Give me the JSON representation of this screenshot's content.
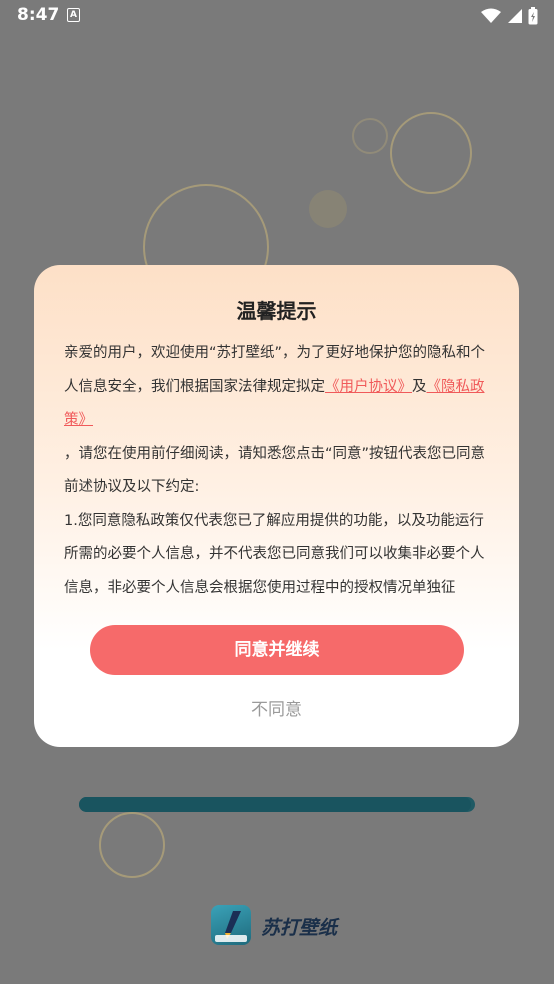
{
  "status_bar": {
    "time": "8:47",
    "notification_icon": "A"
  },
  "dialog": {
    "title": "温馨提示",
    "intro_before": "亲爱的用户，欢迎使用“苏打壁纸”，为了更好地保护您的隐私和个人信息安全，我们根据国家法律规定拟定",
    "link_user_agreement": "《用户协议》",
    "connector": "及",
    "link_privacy_policy": "《隐私政策》",
    "intro_after": "，请您在使用前仔细阅读，请知悉您点击“同意”按钮代表您已同意前述协议及以下约定:",
    "clause_1": "1.您同意隐私政策仅代表您已了解应用提供的功能，以及功能运行所需的必要个人信息，并不代表您已同意我们可以收集非必要个人信息，非必要个人信息会根据您使用过程中的授权情况单独征",
    "agree_label": "同意并继续",
    "disagree_label": "不同意"
  },
  "background": {
    "progress": 0.99,
    "brand_name": "苏打壁纸",
    "brand_icon_text": "苏打壁纸"
  },
  "colors": {
    "accent": "#f66a6a",
    "link": "#f05a5a",
    "overlay": "#7a7a7a"
  }
}
